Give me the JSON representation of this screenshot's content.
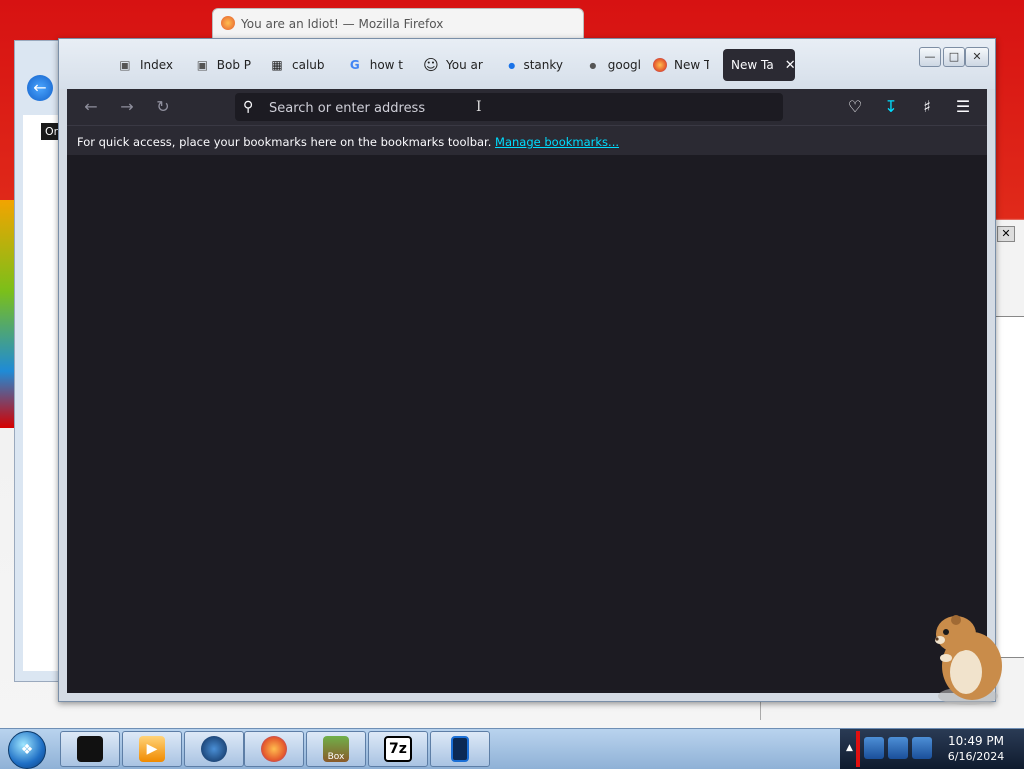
{
  "ghost_window": {
    "title": "You are an Idiot! — Mozilla Firefox"
  },
  "explorer_fragment": {
    "label": "Org"
  },
  "firefox": {
    "tabs": [
      {
        "label": "Index",
        "icon": "page-icon"
      },
      {
        "label": "Bob P",
        "icon": "page-icon"
      },
      {
        "label": "calub",
        "icon": "building-icon"
      },
      {
        "label": "how t",
        "icon": "google-icon"
      },
      {
        "label": "You ar",
        "icon": "smiley-icon"
      },
      {
        "label": "stanky",
        "icon": "loading-dot-icon"
      },
      {
        "label": "googl",
        "icon": "loading-dot-icon"
      },
      {
        "label": "New T",
        "icon": "firefox-icon"
      },
      {
        "label": "New Ta",
        "active": true
      }
    ],
    "window_controls": {
      "minimize": "—",
      "maximize": "□",
      "close": "✕"
    },
    "urlbar": {
      "placeholder": "Search or enter address",
      "value": ""
    },
    "bookmarks_bar": {
      "message": "For quick access, place your bookmarks here on the bookmarks toolbar.",
      "link": "Manage bookmarks..."
    },
    "accent_color": "#00ddff"
  },
  "taskbar": {
    "apps": [
      {
        "name": "black-box-icon"
      },
      {
        "name": "media-player-icon"
      },
      {
        "name": "globe-icon"
      },
      {
        "name": "firefox-icon"
      },
      {
        "name": "bonzi-box-icon",
        "label": "Box"
      },
      {
        "name": "7zip-icon",
        "label": "7z"
      },
      {
        "name": "tablet-icon"
      }
    ],
    "clock": {
      "time": "10:49 PM",
      "date": "6/16/2024"
    }
  }
}
